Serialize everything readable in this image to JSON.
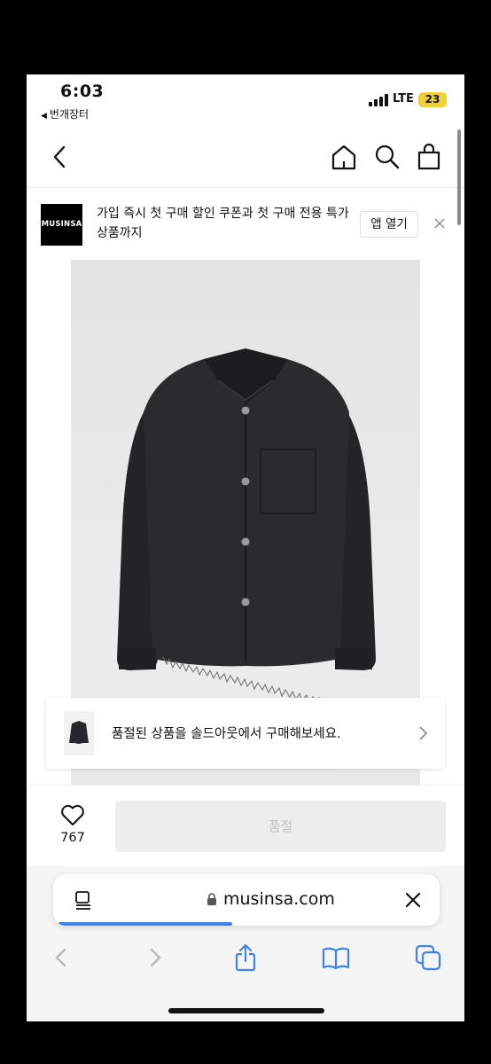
{
  "status_bar": {
    "time": "6:03",
    "back_app": "번개장터",
    "network": "LTE",
    "battery": "23"
  },
  "nav": {
    "icons": [
      "chevron-left-icon",
      "home-icon",
      "search-icon",
      "bag-icon"
    ]
  },
  "banner": {
    "logo": "MUSINSA",
    "text": "가입 즉시 첫 구매 할인 쿠폰과 첫 구매 전용 특가 상품까지",
    "open_app_label": "앱 열기"
  },
  "soldout_card": {
    "text": "품절된 상품을 솔드아웃에서 구매해보세요."
  },
  "action_bar": {
    "like_count": "767",
    "buy_label": "품절"
  },
  "browser": {
    "url": "musinsa.com",
    "load_progress": 0.45
  },
  "colors": {
    "accent_blue": "#3e83f0",
    "battery_yellow": "#f1d13a",
    "disabled_button": "#ededed"
  }
}
